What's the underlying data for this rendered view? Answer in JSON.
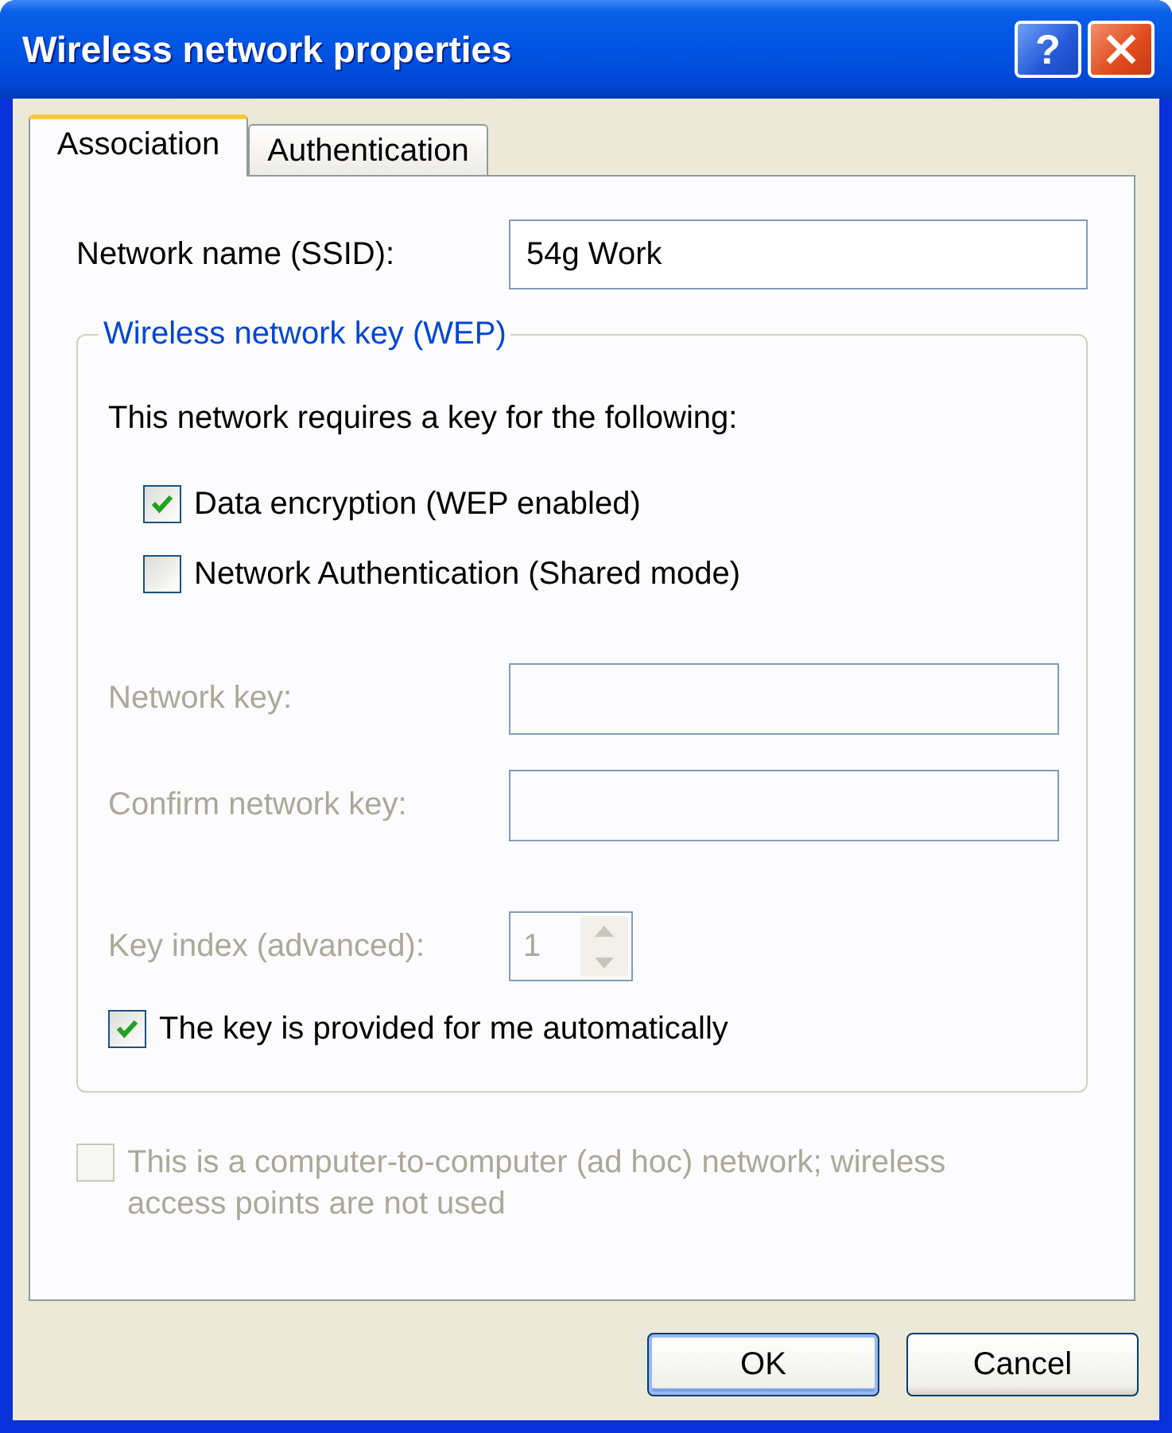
{
  "window": {
    "title": "Wireless network properties",
    "help_button": "?"
  },
  "tabs": [
    {
      "label": "Association",
      "selected": true
    },
    {
      "label": "Authentication",
      "selected": false
    }
  ],
  "network_name": {
    "label": "Network name (SSID):",
    "value": "54g Work"
  },
  "key_group": {
    "title": "Wireless network key (WEP)",
    "intro": "This network requires a key for the following:",
    "options": [
      {
        "label": "Data encryption (WEP enabled)",
        "checked": true,
        "disabled": false
      },
      {
        "label": "Network Authentication (Shared mode)",
        "checked": false,
        "disabled": false
      }
    ],
    "fields": [
      {
        "label": "Network key:",
        "disabled": true
      },
      {
        "label": "Confirm network key:",
        "disabled": true
      }
    ],
    "key_index": {
      "label": "Key index (advanced):",
      "value": "1",
      "disabled": true
    },
    "auto_key": {
      "label": "The key is provided for me automatically",
      "checked": true,
      "disabled": false
    }
  },
  "adhoc": {
    "label": "This is a computer-to-computer (ad hoc) network; wireless access points are not used",
    "checked": false,
    "disabled": true
  },
  "buttons": [
    {
      "label": "OK",
      "default": true
    },
    {
      "label": "Cancel",
      "default": false
    }
  ]
}
